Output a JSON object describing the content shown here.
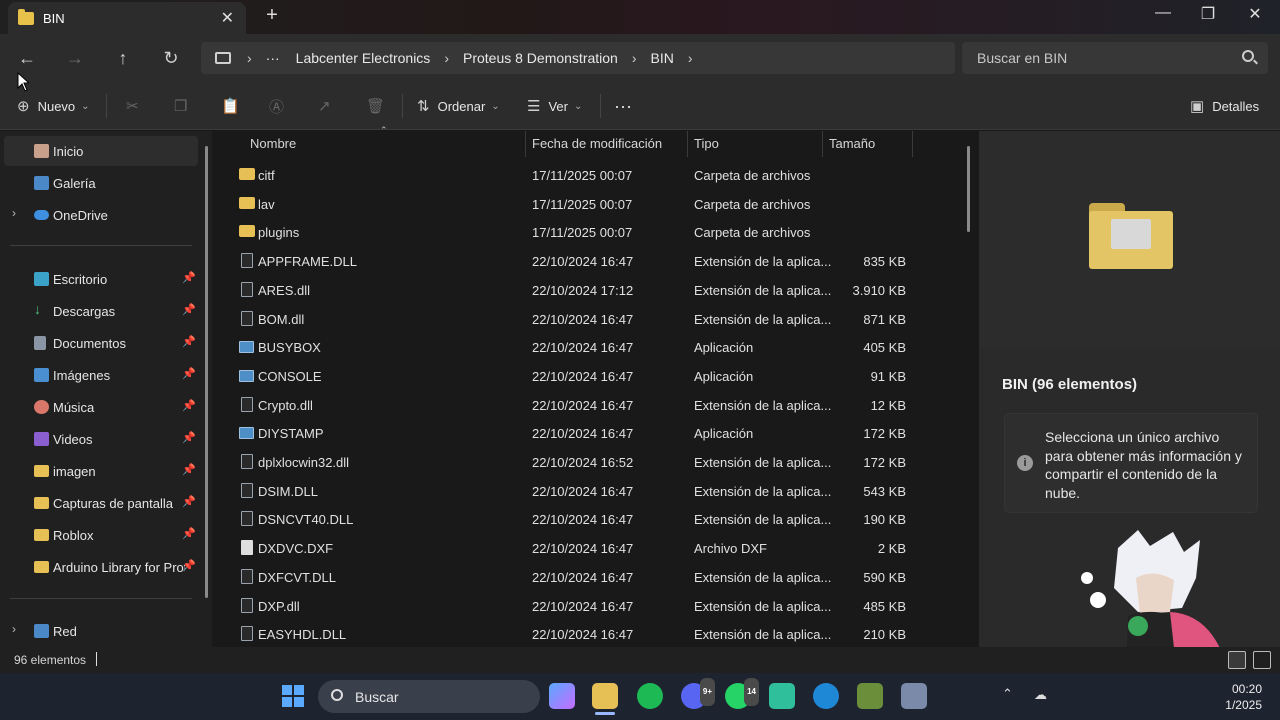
{
  "window": {
    "tab_title": "BIN",
    "new_tab": "+",
    "minimize": "—",
    "restore": "❐",
    "close": "✕"
  },
  "nav": {
    "back": "←",
    "forward": "→",
    "up": "↑",
    "refresh": "↻"
  },
  "breadcrumb": {
    "more": "···",
    "items": [
      "Labcenter Electronics",
      "Proteus 8 Demonstration",
      "BIN"
    ]
  },
  "search": {
    "placeholder": "Buscar en BIN"
  },
  "toolbar": {
    "new_label": "Nuevo",
    "sort_label": "Ordenar",
    "view_label": "Ver",
    "more": "···",
    "details_label": "Detalles"
  },
  "sidebar": {
    "items": [
      {
        "label": "Inicio",
        "icon": "home-icon"
      },
      {
        "label": "Galería",
        "icon": "gallery-icon"
      },
      {
        "label": "OneDrive",
        "icon": "cloud-icon"
      },
      {
        "label": "Escritorio",
        "icon": "desktop-icon"
      },
      {
        "label": "Descargas",
        "icon": "download-icon"
      },
      {
        "label": "Documentos",
        "icon": "documents-icon"
      },
      {
        "label": "Imágenes",
        "icon": "pictures-icon"
      },
      {
        "label": "Música",
        "icon": "music-icon"
      },
      {
        "label": "Videos",
        "icon": "videos-icon"
      },
      {
        "label": "imagen",
        "icon": "folder-icon"
      },
      {
        "label": "Capturas de pantalla",
        "icon": "folder-icon"
      },
      {
        "label": "Roblox",
        "icon": "folder-icon"
      },
      {
        "label": "Arduino Library for Proteus",
        "icon": "folder-icon"
      },
      {
        "label": "Red",
        "icon": "network-icon"
      }
    ]
  },
  "columns": {
    "name": "Nombre",
    "date": "Fecha de modificación",
    "type": "Tipo",
    "size": "Tamaño"
  },
  "files": [
    {
      "name": "citf",
      "date": "17/11/2025 00:07",
      "type": "Carpeta de archivos",
      "size": "",
      "kind": "folder"
    },
    {
      "name": "lav",
      "date": "17/11/2025 00:07",
      "type": "Carpeta de archivos",
      "size": "",
      "kind": "folder"
    },
    {
      "name": "plugins",
      "date": "17/11/2025 00:07",
      "type": "Carpeta de archivos",
      "size": "",
      "kind": "folder"
    },
    {
      "name": "APPFRAME.DLL",
      "date": "22/10/2024 16:47",
      "type": "Extensión de la aplica...",
      "size": "835 KB",
      "kind": "dll"
    },
    {
      "name": "ARES.dll",
      "date": "22/10/2024 17:12",
      "type": "Extensión de la aplica...",
      "size": "3.910 KB",
      "kind": "dll"
    },
    {
      "name": "BOM.dll",
      "date": "22/10/2024 16:47",
      "type": "Extensión de la aplica...",
      "size": "871 KB",
      "kind": "dll"
    },
    {
      "name": "BUSYBOX",
      "date": "22/10/2024 16:47",
      "type": "Aplicación",
      "size": "405 KB",
      "kind": "app"
    },
    {
      "name": "CONSOLE",
      "date": "22/10/2024 16:47",
      "type": "Aplicación",
      "size": "91 KB",
      "kind": "app"
    },
    {
      "name": "Crypto.dll",
      "date": "22/10/2024 16:47",
      "type": "Extensión de la aplica...",
      "size": "12 KB",
      "kind": "dll"
    },
    {
      "name": "DIYSTAMP",
      "date": "22/10/2024 16:47",
      "type": "Aplicación",
      "size": "172 KB",
      "kind": "app"
    },
    {
      "name": "dplxlocwin32.dll",
      "date": "22/10/2024 16:52",
      "type": "Extensión de la aplica...",
      "size": "172 KB",
      "kind": "dll"
    },
    {
      "name": "DSIM.DLL",
      "date": "22/10/2024 16:47",
      "type": "Extensión de la aplica...",
      "size": "543 KB",
      "kind": "dll"
    },
    {
      "name": "DSNCVT40.DLL",
      "date": "22/10/2024 16:47",
      "type": "Extensión de la aplica...",
      "size": "190 KB",
      "kind": "dll"
    },
    {
      "name": "DXDVC.DXF",
      "date": "22/10/2024 16:47",
      "type": "Archivo DXF",
      "size": "2 KB",
      "kind": "dxf"
    },
    {
      "name": "DXFCVT.DLL",
      "date": "22/10/2024 16:47",
      "type": "Extensión de la aplica...",
      "size": "590 KB",
      "kind": "dll"
    },
    {
      "name": "DXP.dll",
      "date": "22/10/2024 16:47",
      "type": "Extensión de la aplica...",
      "size": "485 KB",
      "kind": "dll"
    },
    {
      "name": "EASYHDL.DLL",
      "date": "22/10/2024 16:47",
      "type": "Extensión de la aplica...",
      "size": "210 KB",
      "kind": "dll"
    }
  ],
  "details_pane": {
    "title": "BIN (96 elementos)",
    "info": "Selecciona un único archivo para obtener más información y compartir el contenido de la nube."
  },
  "status": {
    "count": "96 elementos"
  },
  "taskbar": {
    "search_label": "Buscar",
    "badge_discord": "9+",
    "badge_whatsapp": "14",
    "time": "00:20",
    "date": "1/2025"
  },
  "colors": {
    "folder": "#e6bf55",
    "accent": "#5aa9ff"
  }
}
